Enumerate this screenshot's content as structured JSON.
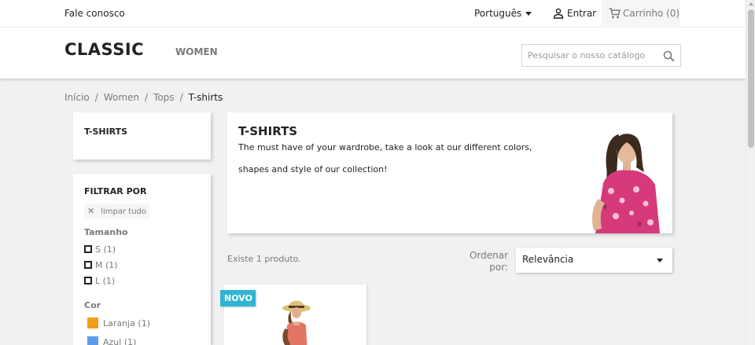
{
  "topnav": {
    "contact": "Fale conosco",
    "language": "Português",
    "login": "Entrar",
    "cart": "Carrinho (0)"
  },
  "header": {
    "logo": "CLASSIC",
    "menu_women": "WOMEN",
    "search_placeholder": "Pesquisar o nosso catálogo"
  },
  "breadcrumb": [
    "Início",
    "Women",
    "Tops",
    "T-shirts"
  ],
  "sidebar": {
    "category_title": "T-SHIRTS",
    "filter_title": "FILTRAR POR",
    "clear_all": "limpar tudo",
    "size_title": "Tamanho",
    "sizes": [
      "S (1)",
      "M (1)",
      "L (1)"
    ],
    "color_title": "Cor",
    "colors": [
      {
        "label": "Laranja (1)",
        "hex": "#f39d1a"
      },
      {
        "label": "Azul (1)",
        "hex": "#5d9cec"
      }
    ]
  },
  "category": {
    "title": "T-SHIRTS",
    "description_line1": "The must have of your wardrobe, take a look at our different colors,",
    "description_line2": "shapes and style of our collection!"
  },
  "listing": {
    "count": "Existe 1 produto.",
    "sort_label": "Ordenar por:",
    "sort_value": "Relevância",
    "badge": "NOVO"
  },
  "colors": {
    "accent": "#2fb5d2",
    "text": "#232323",
    "muted": "#7a7a7a",
    "background": "#f1f1f1"
  }
}
